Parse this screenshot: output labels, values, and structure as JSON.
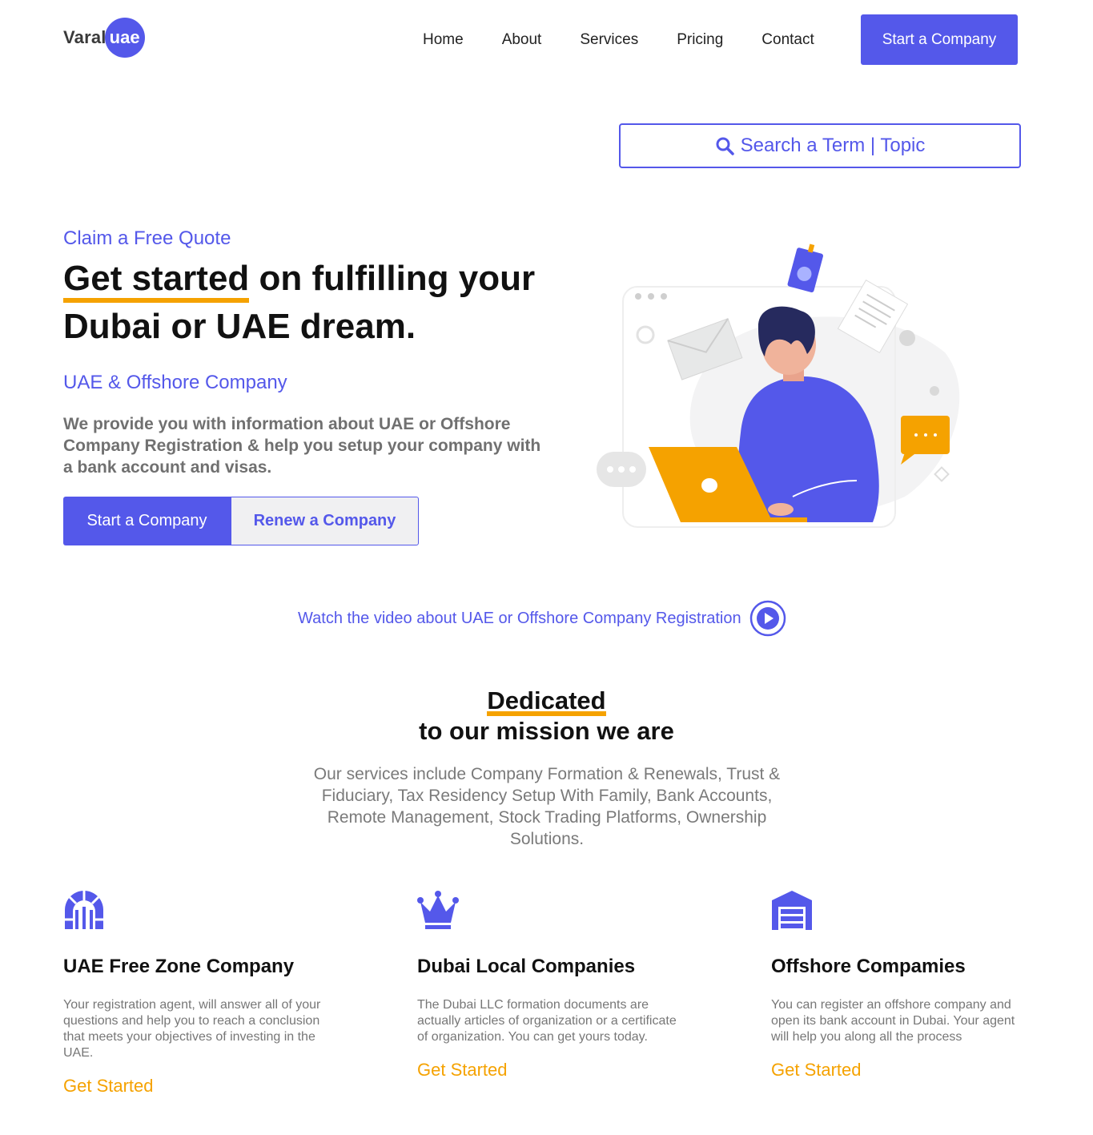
{
  "brand": {
    "name": "Varal",
    "badge": "uae"
  },
  "nav": {
    "items": [
      "Home",
      "About",
      "Services",
      "Pricing",
      "Contact"
    ],
    "cta": "Start a Company"
  },
  "search": {
    "label": "Search a Term | Topic",
    "icon": "search-icon"
  },
  "hero": {
    "eyebrow": "Claim a Free Quote",
    "title_highlight": "Get started",
    "title_rest_line1": " on fulfilling your",
    "title_line2": "Dubai or UAE dream.",
    "subhead": "UAE & Offshore Company",
    "description": "We provide you with information about UAE or Offshore Company Registration & help you setup your company with a bank account and visas.",
    "primary_button": "Start a Company",
    "secondary_button": "Renew a Company"
  },
  "video": {
    "label": "Watch the video about UAE or Offshore Company Registration",
    "icon": "play-icon"
  },
  "mission": {
    "highlight": "Dedicated",
    "subtitle": "to our mission we are",
    "description": "Our services include Company Formation & Renewals, Trust & Fiduciary, Tax Residency Setup With Family, Bank Accounts, Remote Management, Stock Trading Platforms, Ownership Solutions."
  },
  "services": [
    {
      "icon": "archway-icon",
      "title": "UAE Free Zone Company",
      "description": "Your registration agent, will answer all of your questions and help you to reach a conclusion that meets your objectives of investing in the UAE.",
      "cta": "Get Started"
    },
    {
      "icon": "crown-icon",
      "title": "Dubai Local Companies",
      "description": "The Dubai LLC formation documents are actually articles of organization or a certificate of organization. You can get yours today.",
      "cta": "Get Started"
    },
    {
      "icon": "warehouse-icon",
      "title": "Offshore Compamies",
      "description": "You can register an offshore company and open its bank account in Dubai. Your agent will help you along all the process",
      "cta": "Get Started"
    }
  ],
  "colors": {
    "accent": "#5458ea",
    "highlight": "#f5a200",
    "muted_text": "#777777"
  }
}
